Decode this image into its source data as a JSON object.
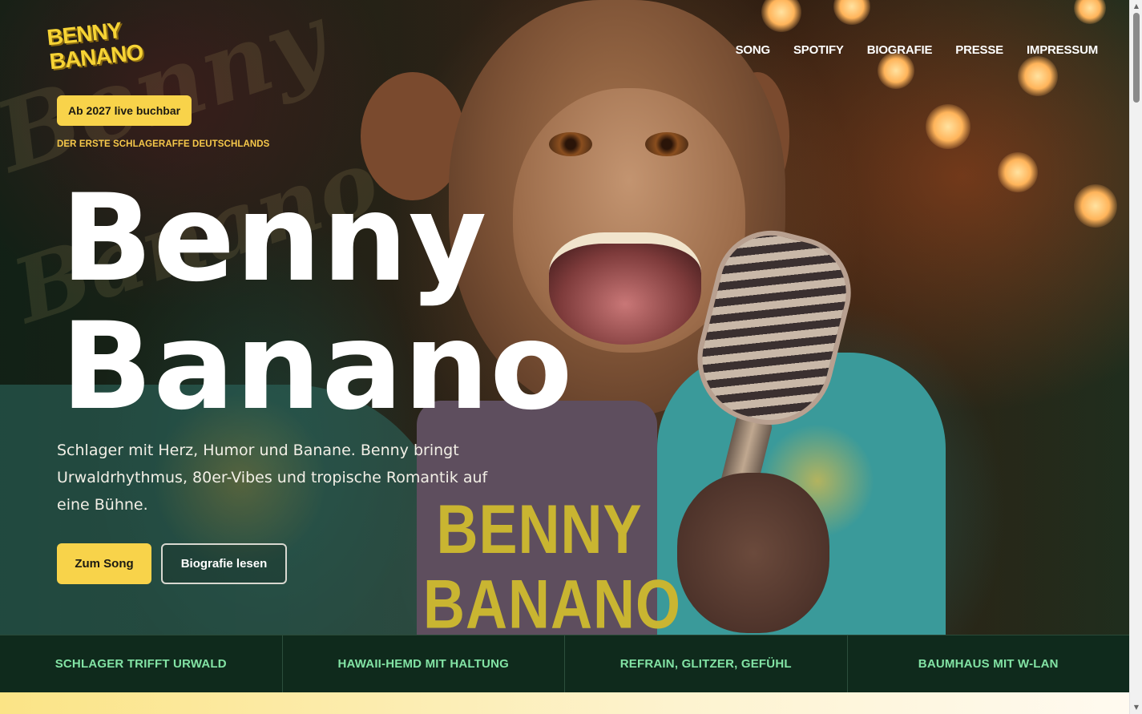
{
  "brand": {
    "logo_line1": "BENNY",
    "logo_line2": "BANANO",
    "accent_color": "#f8d34a",
    "band_text_color": "#82e3a4",
    "band_bg_color": "#0f2a1c"
  },
  "nav": {
    "items": [
      {
        "label": "SONG"
      },
      {
        "label": "SPOTIFY"
      },
      {
        "label": "BIOGRAFIE"
      },
      {
        "label": "PRESSE"
      },
      {
        "label": "IMPRESSUM"
      }
    ]
  },
  "hero": {
    "badge": "Ab 2027 live buchbar",
    "kicker": "DER ERSTE SCHLAGERAFFE DEUTSCHLANDS",
    "title_line1": "Benny",
    "title_line2": "Banano",
    "intro": "Schlager mit Herz, Humor und Banane. Benny bringt Urwaldrhythmus, 80er-Vibes und tropische Romantik auf eine Bühne.",
    "primary_button": "Zum Song",
    "secondary_button": "Biografie lesen",
    "shirt_print_line1": "BENNY",
    "shirt_print_line2": "BANANO"
  },
  "features": [
    {
      "label": "SCHLAGER TRIFFT URWALD"
    },
    {
      "label": "HAWAII-HEMD MIT HALTUNG"
    },
    {
      "label": "REFRAIN, GLITZER, GEFÜHL"
    },
    {
      "label": "BAUMHAUS MIT W-LAN"
    }
  ],
  "icons": {
    "scroll_up": "▲",
    "scroll_down": "▼"
  }
}
